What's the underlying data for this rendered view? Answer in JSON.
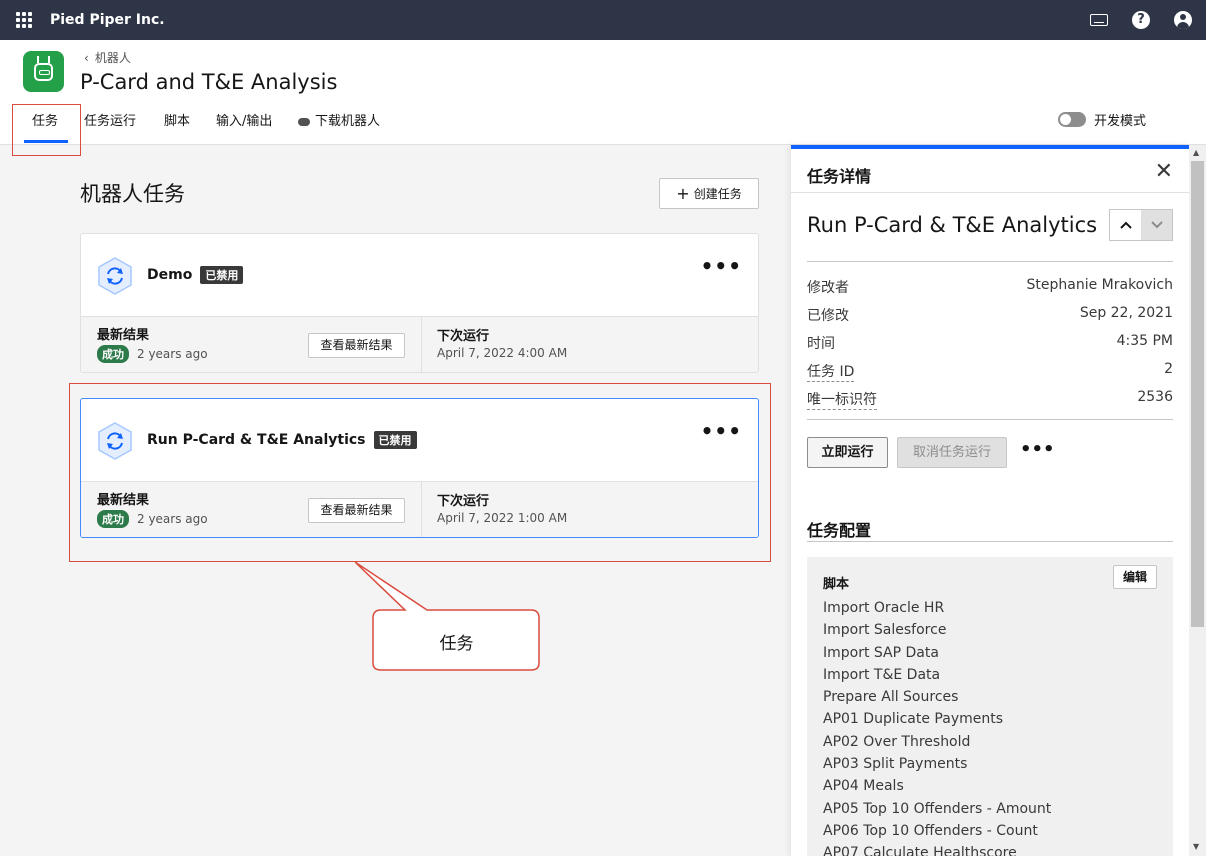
{
  "topbar": {
    "brand": "Pied Piper Inc."
  },
  "header": {
    "breadcrumb": "机器人",
    "title": "P-Card and T&E Analysis",
    "tabs": [
      "任务",
      "任务运行",
      "脚本",
      "输入/输出",
      "下载机器人"
    ],
    "dev_mode_label": "开发模式"
  },
  "main": {
    "section_title": "机器人任务",
    "create_button": "创建任务",
    "tasks": [
      {
        "name": "Demo",
        "status_badge": "已禁用",
        "latest_label": "最新结果",
        "result_badge": "成功",
        "result_time": "2 years ago",
        "view_button": "查看最新结果",
        "next_label": "下次运行",
        "next_run": "April 7, 2022 4:00 AM"
      },
      {
        "name": "Run P-Card & T&E Analytics",
        "status_badge": "已禁用",
        "latest_label": "最新结果",
        "result_badge": "成功",
        "result_time": "2 years ago",
        "view_button": "查看最新结果",
        "next_label": "下次运行",
        "next_run": "April 7, 2022 1:00 AM"
      }
    ],
    "callout_text": "任务"
  },
  "panel": {
    "title": "任务详情",
    "task_name": "Run P-Card & T&E Analytics",
    "meta": [
      {
        "key": "修改者",
        "value": "Stephanie Mrakovich"
      },
      {
        "key": "已修改",
        "value": "Sep 22, 2021"
      },
      {
        "key": "时间",
        "value": "4:35 PM"
      },
      {
        "key": "任务 ID",
        "value": "2"
      },
      {
        "key": "唯一标识符",
        "value": "2536"
      }
    ],
    "run_button": "立即运行",
    "cancel_button": "取消任务运行",
    "config_title": "任务配置",
    "script_label": "脚本",
    "edit_button": "编辑",
    "scripts": [
      "Import Oracle HR",
      "Import Salesforce",
      "Import SAP Data",
      "Import T&E Data",
      "Prepare All Sources",
      "AP01 Duplicate Payments",
      "AP02 Over Threshold",
      "AP03 Split Payments",
      "AP04 Meals",
      "AP05 Top 10 Offenders - Amount",
      "AP06 Top 10 Offenders - Count",
      "AP07 Calculate Healthscore"
    ]
  },
  "colors": {
    "accent": "#0f62fe",
    "topbar": "#2d3546",
    "success": "#2d7a4a",
    "annotation": "#d94b3d"
  }
}
